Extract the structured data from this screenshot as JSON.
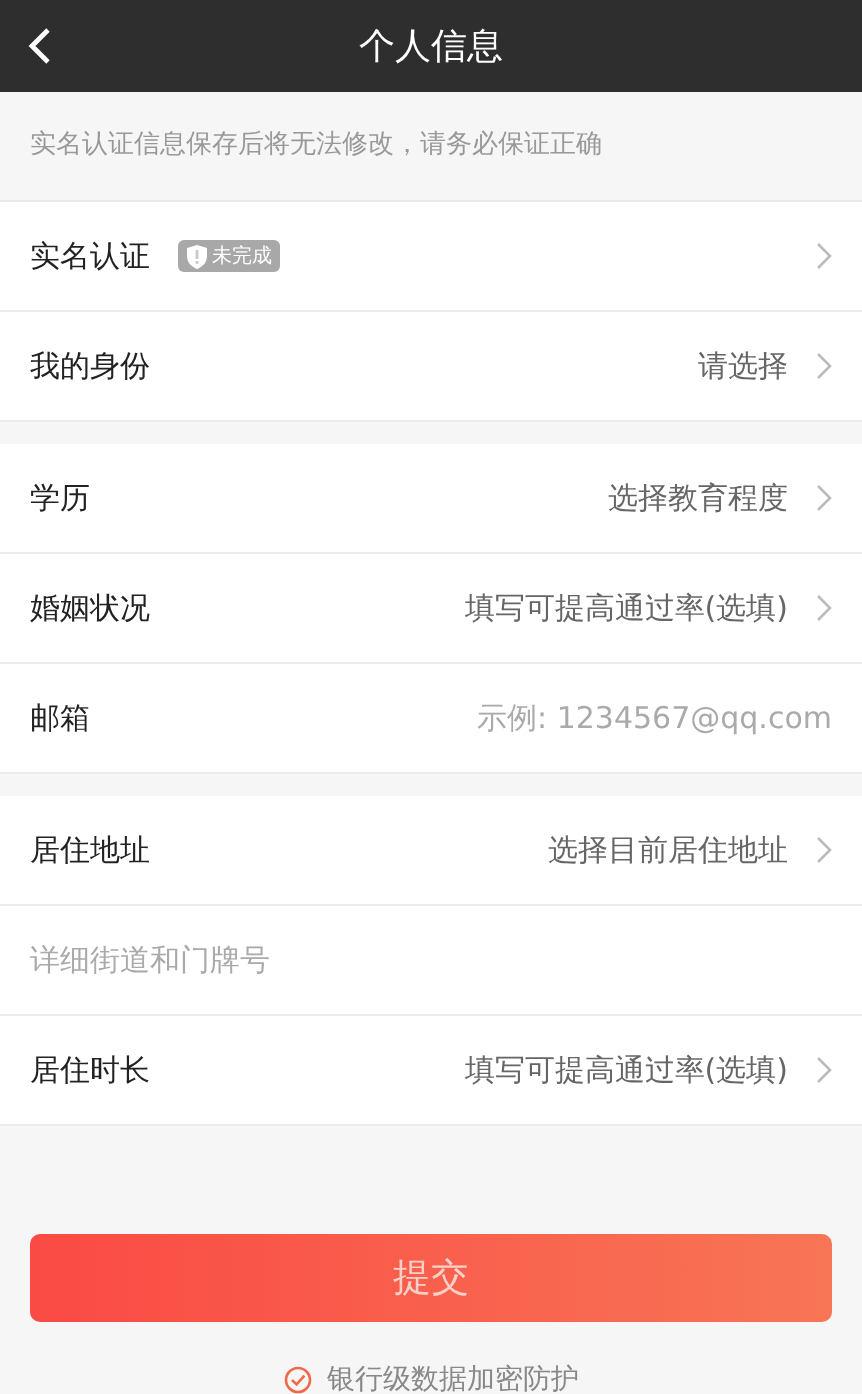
{
  "header": {
    "title": "个人信息"
  },
  "notice": "实名认证信息保存后将无法修改，请务必保证正确",
  "groups": [
    {
      "rows": [
        {
          "kind": "verify",
          "label": "实名认证",
          "badge": "未完成"
        },
        {
          "kind": "select",
          "label": "我的身份",
          "placeholder": "请选择"
        }
      ]
    },
    {
      "rows": [
        {
          "kind": "select",
          "label": "学历",
          "placeholder": "选择教育程度"
        },
        {
          "kind": "select",
          "label": "婚姻状况",
          "placeholder": "填写可提高通过率(选填)"
        },
        {
          "kind": "input",
          "label": "邮箱",
          "placeholder": "示例: 1234567@qq.com"
        }
      ]
    },
    {
      "rows": [
        {
          "kind": "select",
          "label": "居住地址",
          "placeholder": "选择目前居住地址"
        },
        {
          "kind": "textline",
          "placeholder": "详细街道和门牌号"
        },
        {
          "kind": "select",
          "label": "居住时长",
          "placeholder": "填写可提高通过率(选填)"
        }
      ]
    }
  ],
  "submit": {
    "label": "提交"
  },
  "footer_note": "银行级数据加密防护"
}
